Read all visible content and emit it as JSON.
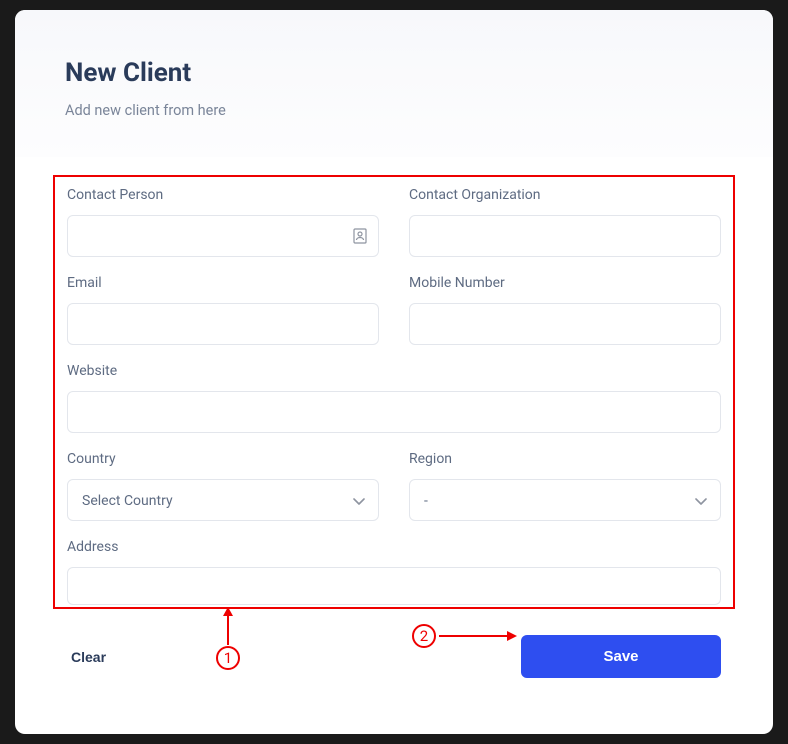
{
  "header": {
    "title": "New Client",
    "subtitle": "Add new client from here"
  },
  "form": {
    "contact_person": {
      "label": "Contact Person",
      "value": ""
    },
    "contact_org": {
      "label": "Contact Organization",
      "value": ""
    },
    "email": {
      "label": "Email",
      "value": ""
    },
    "mobile": {
      "label": "Mobile Number",
      "value": ""
    },
    "website": {
      "label": "Website",
      "value": ""
    },
    "country": {
      "label": "Country",
      "selected": "Select Country"
    },
    "region": {
      "label": "Region",
      "selected": "-"
    },
    "address": {
      "label": "Address",
      "value": ""
    }
  },
  "buttons": {
    "clear": "Clear",
    "save": "Save"
  },
  "annotations": {
    "marker1": "1",
    "marker2": "2"
  }
}
